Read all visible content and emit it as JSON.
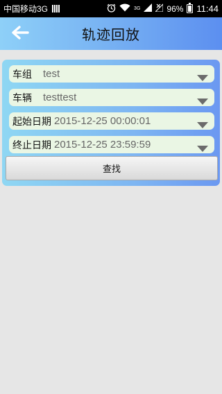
{
  "status_bar": {
    "carrier": "中国移动3G",
    "network_type": "3G",
    "battery": "96%",
    "time": "11:44"
  },
  "header": {
    "title": "轨迹回放"
  },
  "form": {
    "vehicle_group": {
      "label": "车组",
      "value": "test"
    },
    "vehicle": {
      "label": "车辆",
      "value": "testtest"
    },
    "start_date": {
      "label": "起始日期",
      "value": "2015-12-25 00:00:01"
    },
    "end_date": {
      "label": "终止日期",
      "value": "2015-12-25 23:59:59"
    },
    "search_label": "查找"
  },
  "colors": {
    "header_gradient_start": "#8ed0f8",
    "header_gradient_end": "#5c8ff0",
    "field_background": "#eaf6e4",
    "dropdown_arrow": "#6b6b6b",
    "page_background": "#e6e6e6"
  }
}
